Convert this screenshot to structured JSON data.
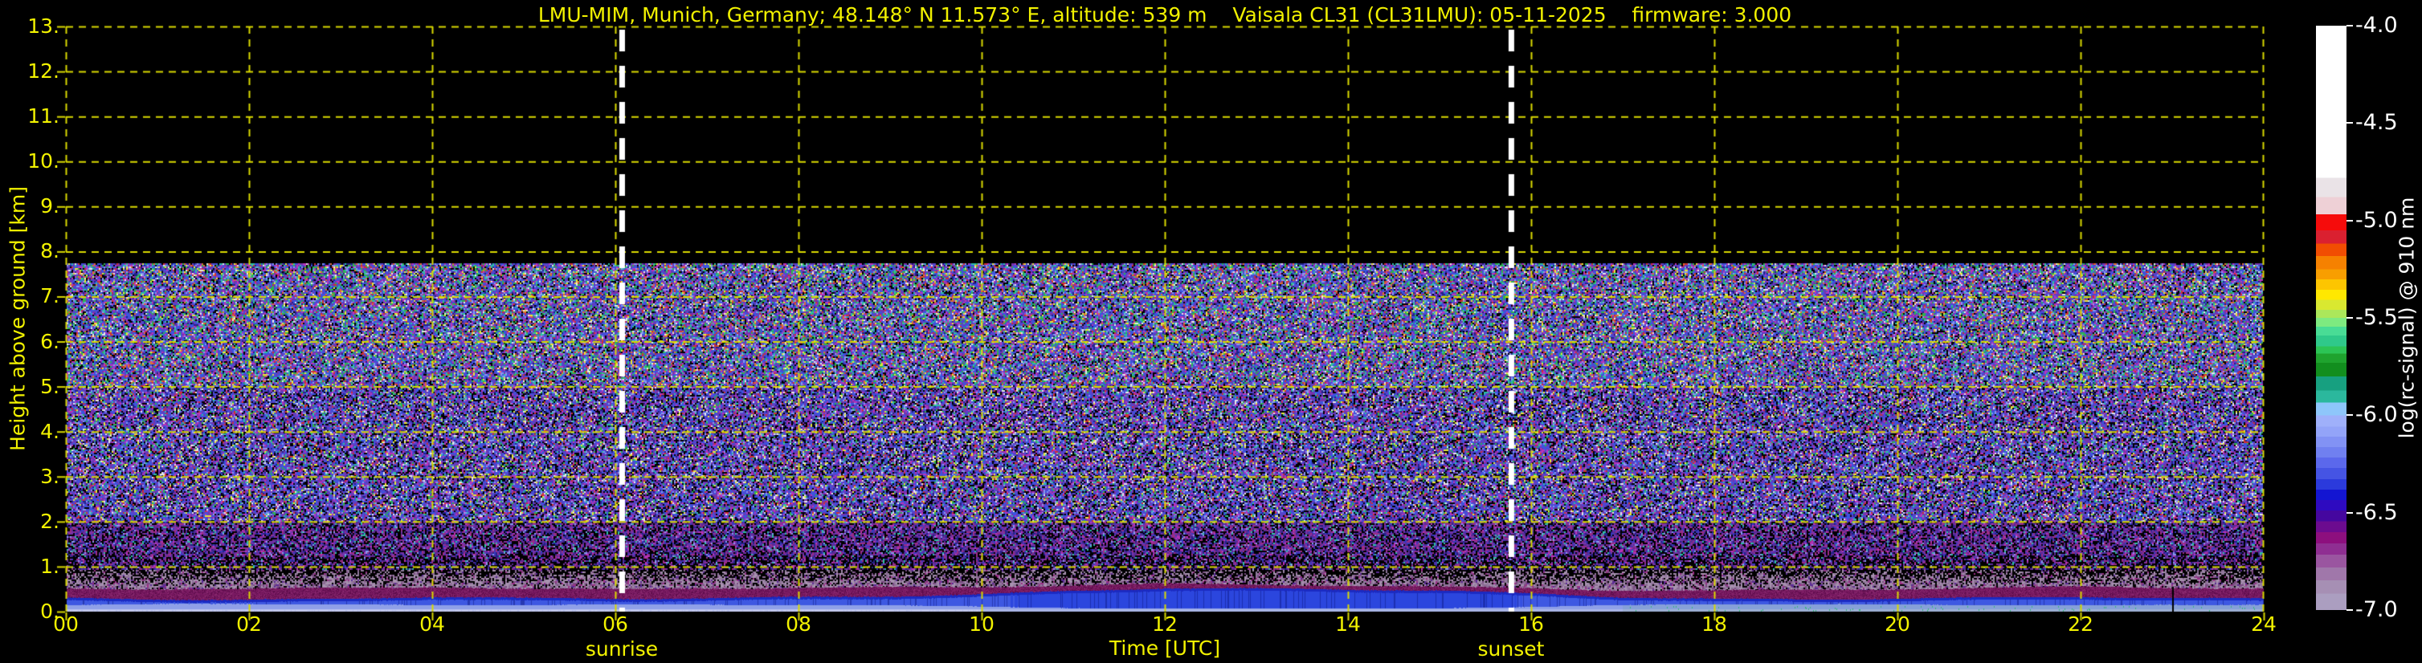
{
  "title": "LMU-MIM, Munich, Germany; 48.148° N 11.573° E, altitude: 539 m    Vaisala CL31 (CL31LMU): 05-11-2025    firmware: 3.000",
  "axes": {
    "x_label": "Time [UTC]",
    "x_tick_labels": [
      "00",
      "02",
      "04",
      "06",
      "08",
      "10",
      "12",
      "14",
      "16",
      "18",
      "20",
      "22",
      "24"
    ],
    "y_label": "Height above ground [km]",
    "y_tick_labels": [
      "0.",
      "1.",
      "2.",
      "3.",
      "4.",
      "5.",
      "6.",
      "7.",
      "8.",
      "9.",
      "10.",
      "11.",
      "12.",
      "13."
    ]
  },
  "annotations": {
    "sunrise_label": "sunrise",
    "sunrise_hour_utc": 6.07,
    "sunset_label": "sunset",
    "sunset_hour_utc": 15.78
  },
  "colorbar": {
    "label": "log(rc-signal) @ 910 nm",
    "tick_labels": [
      "-4.0",
      "-4.5",
      "-5.0",
      "-5.5",
      "-6.0",
      "-6.5",
      "-7.0"
    ],
    "value_top": -4.0,
    "value_bottom": -7.0,
    "stops": [
      [
        0.0,
        "#ffffff"
      ],
      [
        0.26,
        "#eae3e7"
      ],
      [
        0.293,
        "#eed0d6"
      ],
      [
        0.323,
        "#f60b0b"
      ],
      [
        0.35,
        "#da2030"
      ],
      [
        0.373,
        "#f14d02"
      ],
      [
        0.394,
        "#f68100"
      ],
      [
        0.417,
        "#f89e00"
      ],
      [
        0.434,
        "#fdc500"
      ],
      [
        0.452,
        "#ffe800"
      ],
      [
        0.469,
        "#d9e830"
      ],
      [
        0.486,
        "#abe75a"
      ],
      [
        0.5,
        "#7eea80"
      ],
      [
        0.515,
        "#49dc95"
      ],
      [
        0.53,
        "#2fc98a"
      ],
      [
        0.549,
        "#2cc455"
      ],
      [
        0.561,
        "#1fa32e"
      ],
      [
        0.577,
        "#128e1e"
      ],
      [
        0.6,
        "#17a080"
      ],
      [
        0.624,
        "#2bb89d"
      ],
      [
        0.645,
        "#8ec6fa"
      ],
      [
        0.667,
        "#9fb0fa"
      ],
      [
        0.686,
        "#93a4f8"
      ],
      [
        0.703,
        "#8292f4"
      ],
      [
        0.721,
        "#7080f0"
      ],
      [
        0.739,
        "#5b68ec"
      ],
      [
        0.757,
        "#4554e4"
      ],
      [
        0.776,
        "#2b3adc"
      ],
      [
        0.794,
        "#1315d2"
      ],
      [
        0.812,
        "#2e0ac0"
      ],
      [
        0.83,
        "#45079f"
      ],
      [
        0.848,
        "#6c0b8f"
      ],
      [
        0.867,
        "#8d0f7e"
      ],
      [
        0.886,
        "#8f2e92"
      ],
      [
        0.905,
        "#9a55a0"
      ],
      [
        0.927,
        "#a077aa"
      ],
      [
        0.949,
        "#a68fb4"
      ],
      [
        0.972,
        "#ab9ec0"
      ],
      [
        1.0,
        "#ab9ec0"
      ]
    ]
  },
  "colors": {
    "background": "#000000",
    "axis_text": "#f2f200",
    "grid": "#d9d900",
    "sun_line": "#ffffff",
    "colorbar_text": "#ffffff"
  },
  "chart_data": {
    "type": "heatmap",
    "title": "LMU-MIM, Munich, Germany; 48.148° N 11.573° E, altitude: 539 m    Vaisala CL31 (CL31LMU): 05-11-2025    firmware: 3.000",
    "xlabel": "Time [UTC]",
    "ylabel": "Height above ground [km]",
    "zlabel": "log(rc-signal) @ 910 nm",
    "x_range": [
      0,
      24
    ],
    "x_ticks": [
      0,
      2,
      4,
      6,
      8,
      10,
      12,
      14,
      16,
      18,
      20,
      22,
      24
    ],
    "y_range": [
      0,
      13
    ],
    "y_ticks": [
      0,
      1,
      2,
      3,
      4,
      5,
      6,
      7,
      8,
      9,
      10,
      11,
      12,
      13
    ],
    "z_range": [
      -7.0,
      -4.0
    ],
    "z_ticks": [
      -4.0,
      -4.5,
      -5.0,
      -5.5,
      -6.0,
      -6.5,
      -7.0
    ],
    "grid": "yellow dashed, 2 h vertical spacing, 1 km horizontal spacing",
    "annotations": [
      {
        "label": "sunrise",
        "hour_utc": 6.07,
        "style": "white dashed vertical line"
      },
      {
        "label": "sunset",
        "hour_utc": 15.78,
        "style": "white dashed vertical line"
      }
    ],
    "structure": {
      "noise_ceiling_km": 7.75,
      "description": "Black (no signal) above 7.75 km. Dense multicolour speckle noise (signal ~ -5.5 to -7) fills 0.9–7.75 km, bluer/darker toward lower heights. Grey-mauve speckle fringe 0.5–0.9 km tops a solid dark-magenta aerosol layer (~ -6.5) at 0.35–0.55 km, over a blue boundary-layer signal (~ -6.2) that deepens toward midday, a periwinkle band (~ -6.0) near 0.1 km and a pale lavender strip (~ -6.9) at the ground.",
      "boundary_layer_blue_top_km": {
        "hours": [
          0,
          1,
          2,
          3,
          4,
          5,
          6,
          7,
          8,
          9,
          10,
          11,
          12,
          13,
          14,
          15,
          16,
          17,
          18,
          19,
          20,
          21,
          22,
          23,
          24
        ],
        "values": [
          0.3,
          0.27,
          0.26,
          0.28,
          0.33,
          0.3,
          0.28,
          0.3,
          0.32,
          0.34,
          0.38,
          0.46,
          0.52,
          0.51,
          0.49,
          0.47,
          0.4,
          0.32,
          0.28,
          0.27,
          0.29,
          0.31,
          0.33,
          0.3,
          0.29
        ]
      },
      "mauve_fringe_top_km": {
        "hours": [
          0,
          1,
          2,
          3,
          4,
          5,
          6,
          7,
          8,
          9,
          10,
          11,
          12,
          13,
          14,
          15,
          16,
          17,
          18,
          19,
          20,
          21,
          22,
          23,
          24
        ],
        "values": [
          0.52,
          0.5,
          0.5,
          0.53,
          0.55,
          0.5,
          0.5,
          0.52,
          0.52,
          0.54,
          0.55,
          0.58,
          0.62,
          0.6,
          0.58,
          0.55,
          0.52,
          0.47,
          0.47,
          0.48,
          0.5,
          0.53,
          0.55,
          0.53,
          0.52
        ]
      },
      "data_gap_hour": 23.0
    }
  }
}
